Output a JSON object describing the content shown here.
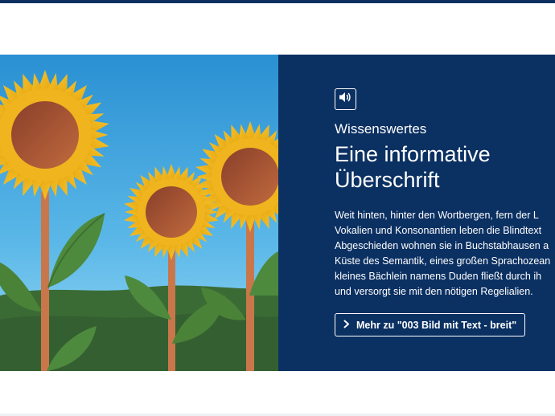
{
  "teaser": {
    "kicker": "Wissenswertes",
    "headline_line1": "Eine informative",
    "headline_line2": "Überschrift",
    "body_lines": [
      "Weit hinten, hinter den Wortbergen, fern der L",
      "Vokalien und Konsonantien leben die Blindtext",
      "Abgeschieden wohnen sie in Buchstabhausen a",
      "Küste des Semantik, eines großen Sprachozean",
      "kleines Bächlein namens Duden fließt durch ih",
      "und versorgt sie mit den nötigen Regelialien."
    ],
    "more_label": "Mehr zu \"003 Bild mit Text - breit\"",
    "icons": {
      "audio": "speaker-icon",
      "more": "chevron-right-icon"
    }
  },
  "colors": {
    "panel": "#0b3062",
    "sky_top": "#2a96d6",
    "sky_bottom": "#8fd3f2",
    "petal": "#f2b61c",
    "center": "#a0522d",
    "leaf": "#4e8a3e",
    "stem": "#c9774a",
    "hill": "#3e6a36"
  }
}
